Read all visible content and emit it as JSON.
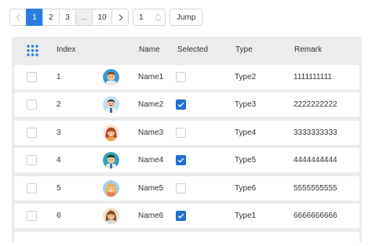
{
  "pagination": {
    "pages": [
      "1",
      "2",
      "3",
      "...",
      "10"
    ],
    "current_page": "1",
    "page_input_value": "1",
    "jump_label": "Jump"
  },
  "table": {
    "columns": {
      "index": "Index",
      "name": "Name",
      "selected": "Selected",
      "type": "Type",
      "remark": "Remark"
    },
    "rows": [
      {
        "index": "1",
        "name": "Name1",
        "selected": false,
        "type": "Type2",
        "remark": "1111111111",
        "avatar": "man-brown-hair-avatar"
      },
      {
        "index": "2",
        "name": "Name2",
        "selected": true,
        "type": "Type3",
        "remark": "2222222222",
        "avatar": "man-mustache-avatar"
      },
      {
        "index": "3",
        "name": "Name3",
        "selected": false,
        "type": "Type4",
        "remark": "3333333333",
        "avatar": "woman-red-hair-avatar"
      },
      {
        "index": "4",
        "name": "Name4",
        "selected": true,
        "type": "Type5",
        "remark": "4444444444",
        "avatar": "man-dark-hair-avatar"
      },
      {
        "index": "5",
        "name": "Name5",
        "selected": false,
        "type": "Type6",
        "remark": "5555555555",
        "avatar": "woman-blonde-avatar"
      },
      {
        "index": "6",
        "name": "Name6",
        "selected": true,
        "type": "Type1",
        "remark": "6666666666",
        "avatar": "woman-brown-hair-avatar"
      }
    ]
  },
  "colors": {
    "accent": "#2b7de0",
    "checkbox_checked": "#1f6fd6",
    "header_bg": "#ececec"
  }
}
